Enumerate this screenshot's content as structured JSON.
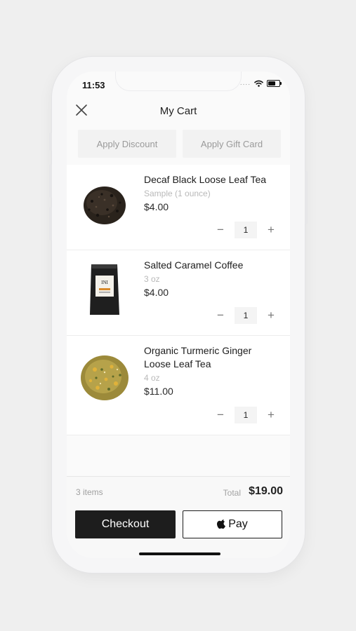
{
  "status": {
    "time": "11:53",
    "signal": "...."
  },
  "header": {
    "title": "My Cart"
  },
  "actions": {
    "discount": "Apply Discount",
    "gift_card": "Apply Gift Card"
  },
  "items": [
    {
      "name": "Decaf Black Loose Leaf Tea",
      "variant": "Sample (1 ounce)",
      "price": "$4.00",
      "qty": "1",
      "image": "loose-black-tea"
    },
    {
      "name": "Salted Caramel Coffee",
      "variant": "3 oz",
      "price": "$4.00",
      "qty": "1",
      "image": "coffee-bag"
    },
    {
      "name": "Organic Turmeric Ginger Loose Leaf Tea",
      "variant": "4 oz",
      "price": "$11.00",
      "qty": "1",
      "image": "turmeric-ginger-tea"
    }
  ],
  "qty_controls": {
    "minus": "−",
    "plus": "+"
  },
  "summary": {
    "count": "3 items",
    "total_label": "Total",
    "total_value": "$19.00"
  },
  "buttons": {
    "checkout": "Checkout",
    "apple_pay": "Pay"
  },
  "colors": {
    "background": "#efefef",
    "checkout_bg": "#1d1d1d",
    "muted_text": "#b9b9b9"
  }
}
